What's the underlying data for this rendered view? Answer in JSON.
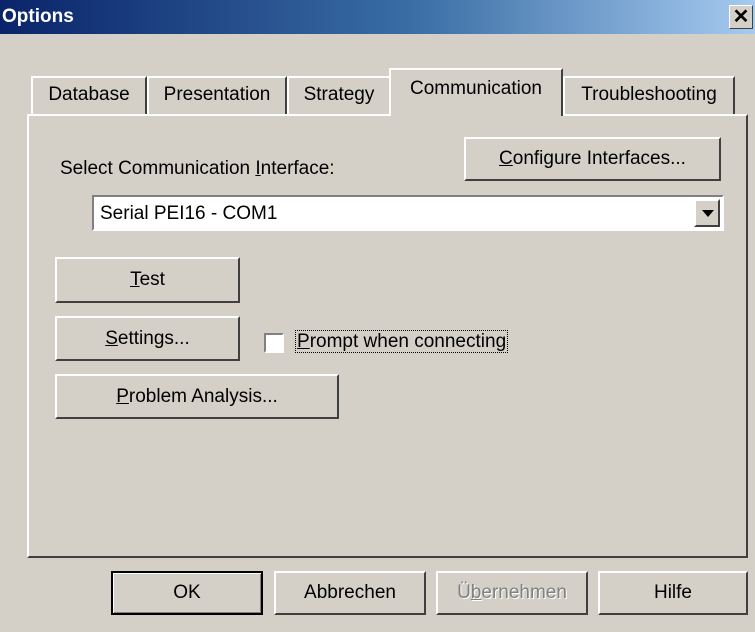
{
  "window": {
    "title": "Options",
    "close_glyph": "✕"
  },
  "tabs": [
    "Database",
    "Presentation",
    "Strategy",
    "Communication",
    "Troubleshooting"
  ],
  "active_tab": "Communication",
  "communication": {
    "interface_label_pre": "Select Communication ",
    "interface_label_mnemonic": "I",
    "interface_label_post": "nterface:",
    "configure_pre": "",
    "configure_mnemonic": "C",
    "configure_post": "onfigure Interfaces...",
    "interface_value": "Serial PEI16 - COM1",
    "test_mnemonic": "T",
    "test_post": "est",
    "settings_mnemonic": "S",
    "settings_post": "ettings...",
    "prompt_mnemonic": "P",
    "prompt_post": "rompt when connecting",
    "prompt_checked": false,
    "problem_mnemonic": "P",
    "problem_post": "roblem Analysis..."
  },
  "footer": {
    "ok": "OK",
    "cancel": "Abbrechen",
    "apply_pre": "Ü",
    "apply_mnemonic": "b",
    "apply_post": "ernehmen",
    "help": "Hilfe"
  },
  "icons": {
    "close": "close-icon",
    "dropdown": "chevron-down-icon"
  }
}
